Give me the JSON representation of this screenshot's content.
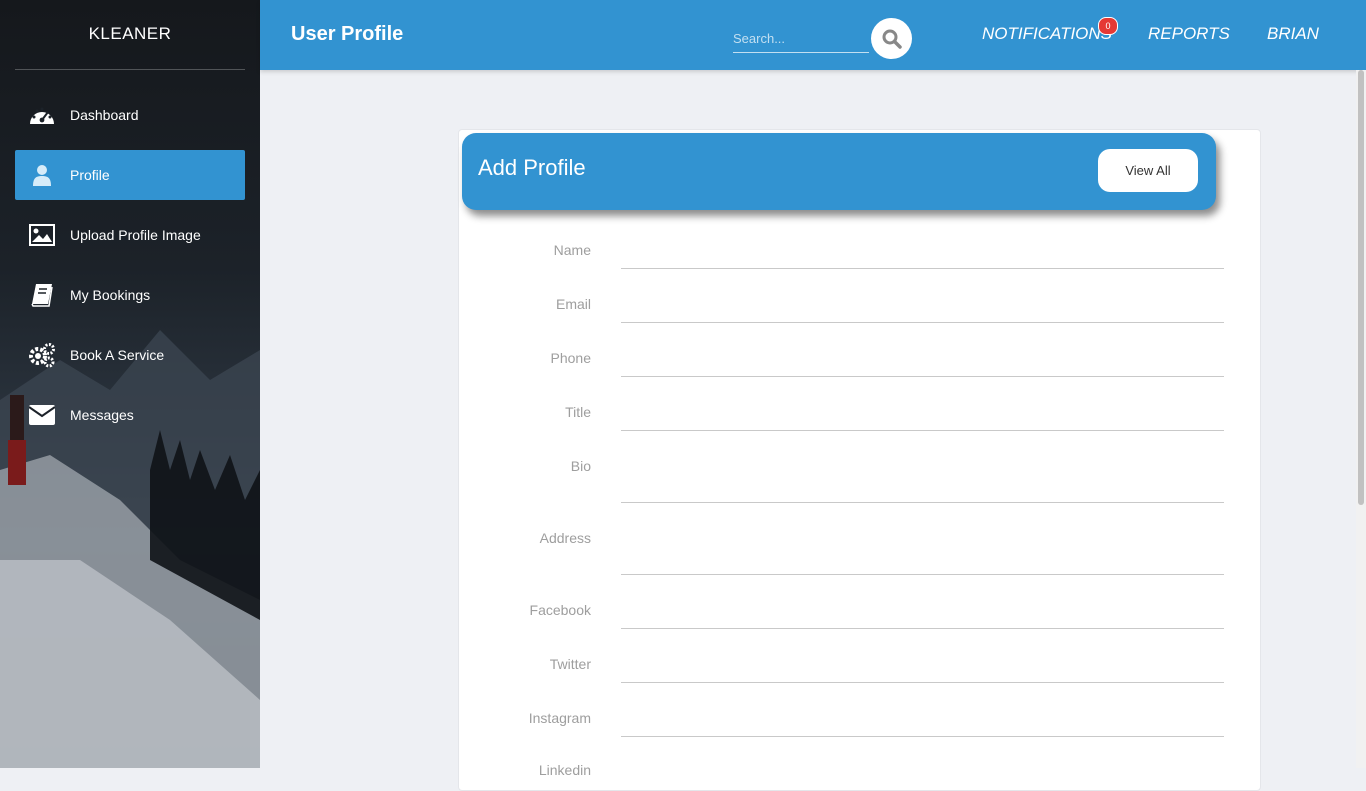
{
  "sidebar": {
    "brand": "KLEANER",
    "items": [
      {
        "label": "Dashboard",
        "icon": "dashboard-gauge-icon",
        "active": false
      },
      {
        "label": "Profile",
        "icon": "user-icon",
        "active": true
      },
      {
        "label": "Upload Profile Image",
        "icon": "image-icon",
        "active": false
      },
      {
        "label": "My Bookings",
        "icon": "book-icon",
        "active": false
      },
      {
        "label": "Book A Service",
        "icon": "gears-icon",
        "active": false
      },
      {
        "label": "Messages",
        "icon": "envelope-icon",
        "active": false
      }
    ]
  },
  "header": {
    "title": "User Profile",
    "search_placeholder": "Search...",
    "nav": {
      "notifications": "NOTIFICATIONS",
      "notification_count": "0",
      "reports": "REPORTS",
      "user": "BRIAN"
    }
  },
  "card": {
    "title": "Add Profile",
    "view_all": "View All",
    "fields": [
      "Name",
      "Email",
      "Phone",
      "Title",
      "Bio",
      "Address",
      "Facebook",
      "Twitter",
      "Instagram",
      "Linkedin"
    ]
  },
  "colors": {
    "primary": "#3293d1",
    "badge": "#e53935",
    "background": "#eef0f4"
  }
}
